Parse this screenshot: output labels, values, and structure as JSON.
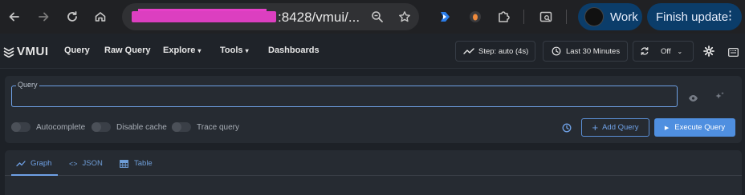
{
  "browser": {
    "url_visible": ":8428/vmui/...",
    "profile_label": "Work",
    "update_label": "Finish update"
  },
  "app": {
    "logo_text": "VMUI",
    "menu": {
      "query": "Query",
      "raw_query": "Raw Query",
      "explore": "Explore",
      "tools": "Tools",
      "dashboards": "Dashboards"
    },
    "step_label": "Step: auto (4s)",
    "time_range": "Last 30 Minutes",
    "refresh_label": "Off"
  },
  "query_panel": {
    "field_label": "Query",
    "field_value": "",
    "toggles": [
      {
        "label": "Autocomplete",
        "on": false
      },
      {
        "label": "Disable cache",
        "on": false
      },
      {
        "label": "Trace query",
        "on": false
      }
    ],
    "add_query_label": "Add Query",
    "execute_label": "Execute Query"
  },
  "results": {
    "tabs": [
      {
        "label": "Graph",
        "active": true
      },
      {
        "label": "JSON",
        "active": false
      },
      {
        "label": "Table",
        "active": false
      }
    ]
  },
  "colors": {
    "accent": "#6fa1e6",
    "execute_bg": "#4f8fe0",
    "profile_bg": "#0b3d6a",
    "redaction": "#e640c8"
  }
}
